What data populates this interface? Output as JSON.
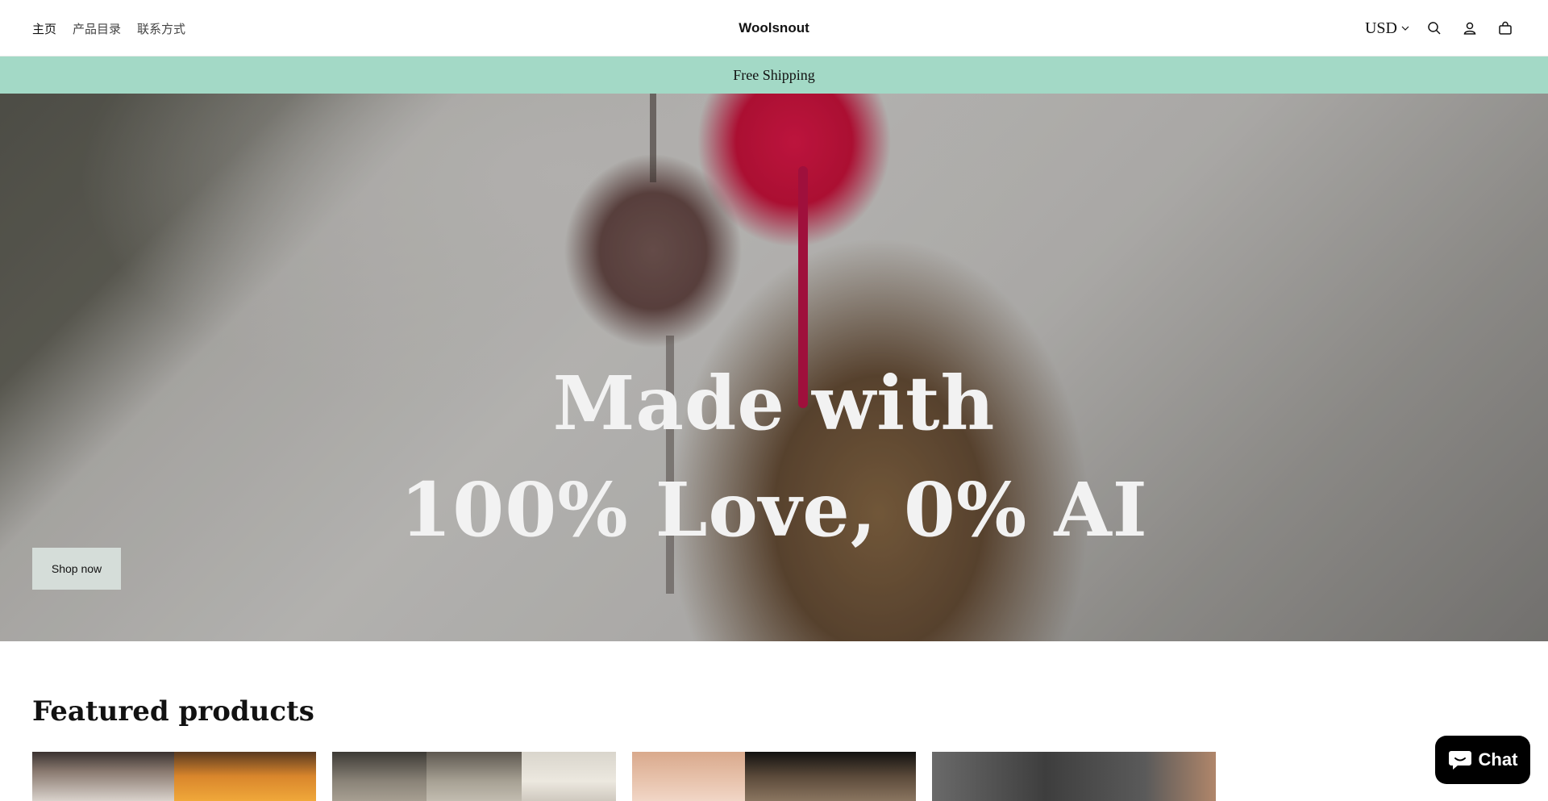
{
  "header": {
    "nav": [
      {
        "label": "主页",
        "active": true
      },
      {
        "label": "产品目录",
        "active": false
      },
      {
        "label": "联系方式",
        "active": false
      }
    ],
    "logo": "Woolsnout",
    "currency": "USD"
  },
  "announcement": "Free Shipping",
  "hero": {
    "line1": "Made with",
    "line2": "100% Love, 0% AI",
    "button": "Shop now"
  },
  "featured": {
    "title": "Featured products"
  },
  "chat": {
    "label": "Chat"
  },
  "colors": {
    "announcement_bg": "#a3d9c6",
    "button_bg": "#d5ddd9",
    "chat_bg": "#000000"
  }
}
